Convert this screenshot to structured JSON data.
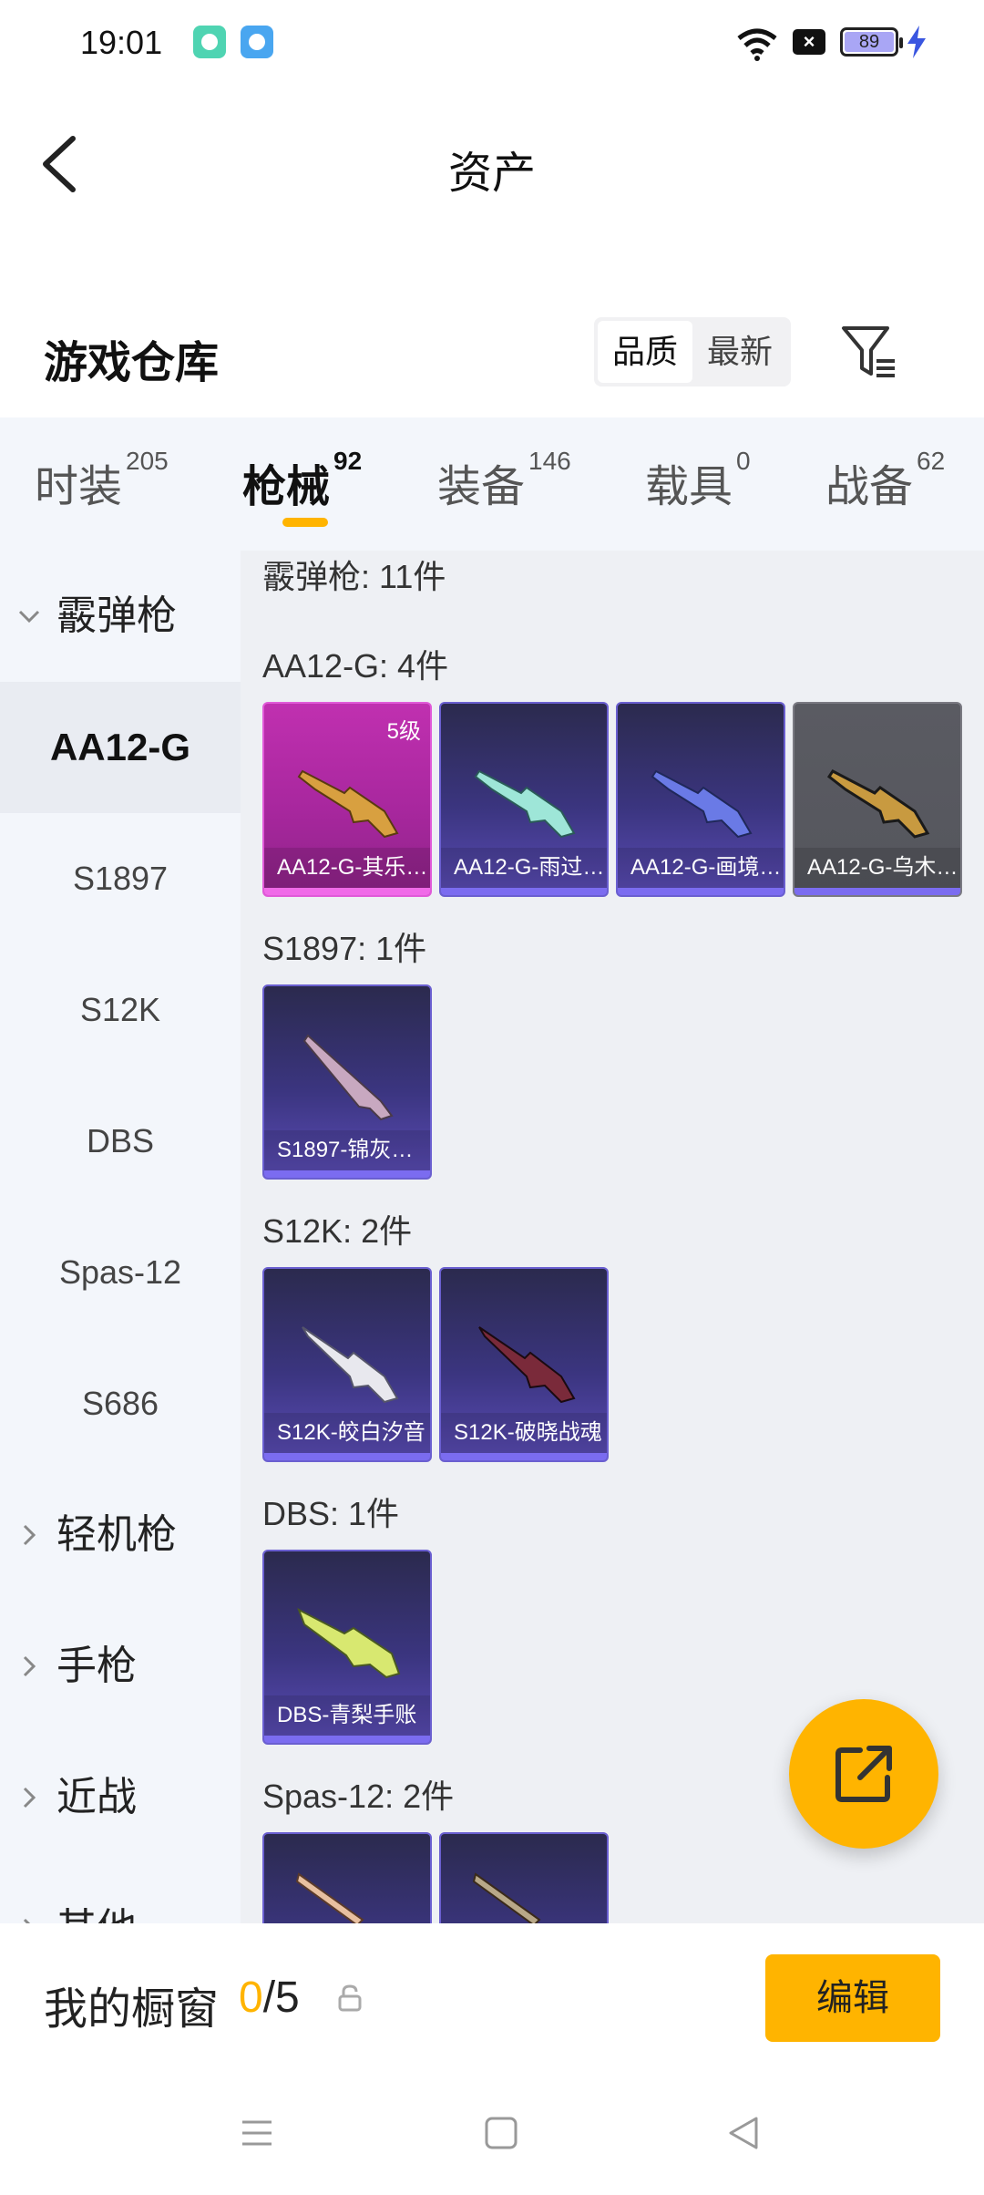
{
  "status": {
    "time": "19:01",
    "battery": "89"
  },
  "header": {
    "title": "资产"
  },
  "warehouse": {
    "title": "游戏仓库",
    "sort_options": [
      "品质",
      "最新"
    ],
    "active_sort": "品质"
  },
  "tabs": [
    {
      "label": "时装",
      "count": "205"
    },
    {
      "label": "枪械",
      "count": "92"
    },
    {
      "label": "装备",
      "count": "146"
    },
    {
      "label": "载具",
      "count": "0"
    },
    {
      "label": "战备",
      "count": "62"
    }
  ],
  "sidebar": {
    "groups": {
      "shotgun": "霰弹枪",
      "lmg": "轻机枪",
      "pistol": "手枪",
      "melee": "近战",
      "other": "其他"
    },
    "items": [
      "AA12-G",
      "S1897",
      "S12K",
      "DBS",
      "Spas-12",
      "S686"
    ],
    "selected": "AA12-G"
  },
  "content": {
    "header_partial": "霰弹枪: 11件",
    "sections": [
      {
        "label": "AA12-G: 4件",
        "cards": [
          {
            "name": "AA12-G-其乐…",
            "level": "5级",
            "rarity": "pink"
          },
          {
            "name": "AA12-G-雨过…",
            "rarity": "purple"
          },
          {
            "name": "AA12-G-画境…",
            "rarity": "purple"
          },
          {
            "name": "AA12-G-乌木…",
            "rarity": "gray"
          }
        ]
      },
      {
        "label": "S1897: 1件",
        "cards": [
          {
            "name": "S1897-锦灰…",
            "rarity": "purple"
          }
        ]
      },
      {
        "label": "S12K: 2件",
        "cards": [
          {
            "name": "S12K-皎白汐音",
            "rarity": "purple"
          },
          {
            "name": "S12K-破晓战魂",
            "rarity": "purple"
          }
        ]
      },
      {
        "label": "DBS: 1件",
        "cards": [
          {
            "name": "DBS-青梨手账",
            "rarity": "purple"
          }
        ]
      },
      {
        "label": "Spas-12: 2件",
        "cards": []
      }
    ]
  },
  "bottom": {
    "window_label": "我的橱窗",
    "window_current": "0",
    "window_total": "/5",
    "edit_label": "编辑"
  },
  "colors": {
    "accent": "#ffb400",
    "pink_rarity": "#c030b0",
    "purple_rarity": "#3b3580"
  }
}
